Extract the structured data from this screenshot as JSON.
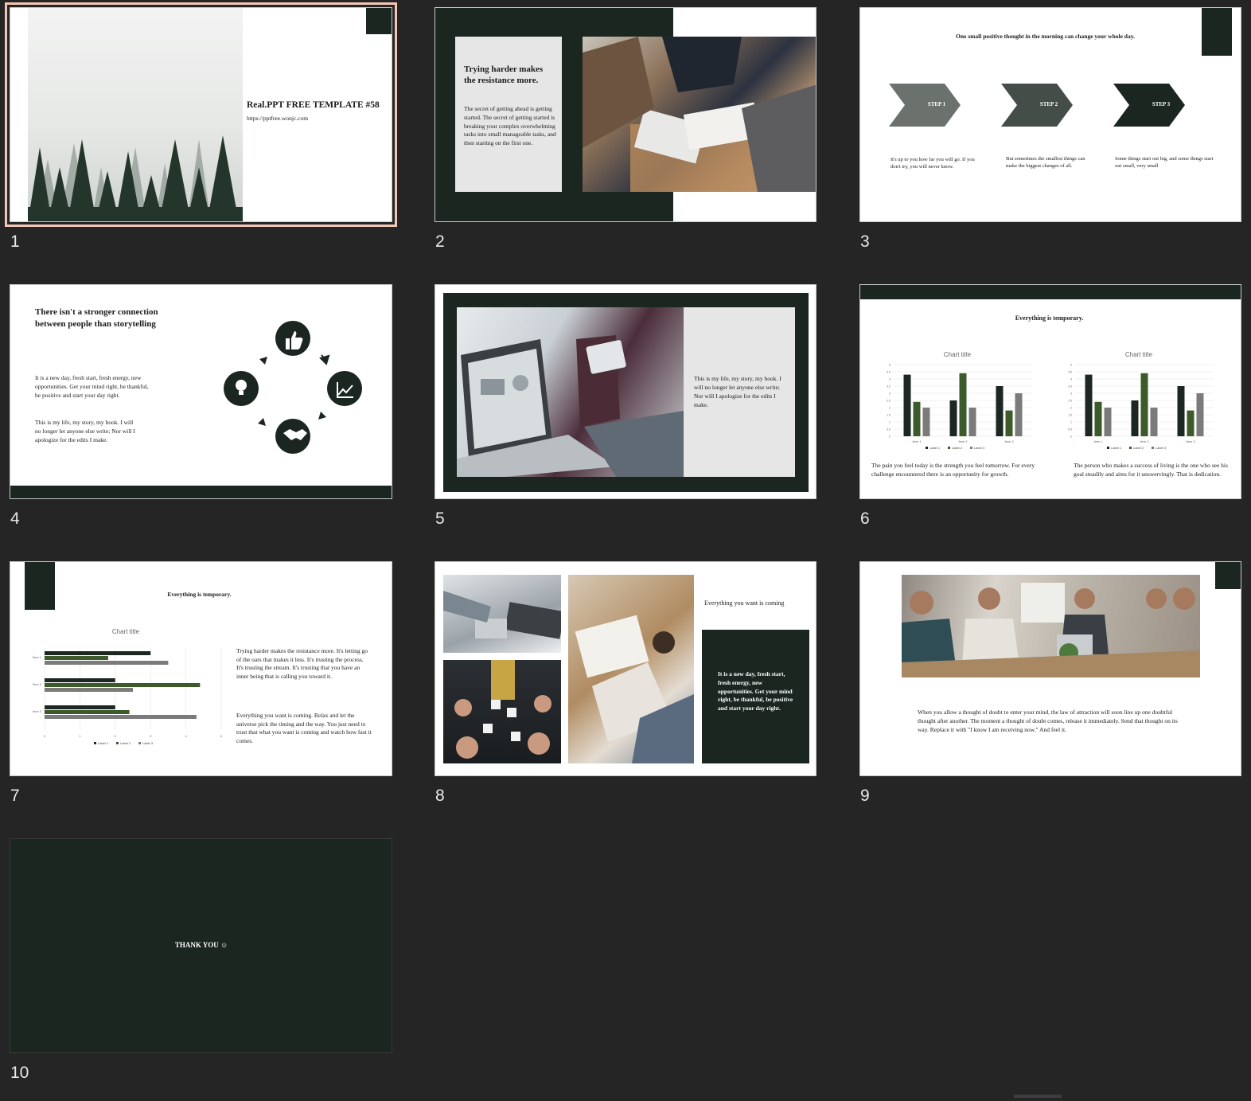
{
  "colors": {
    "background": "#252526",
    "dark_green": "#1b2621",
    "step1": "#6b726d",
    "step2": "#454d48",
    "step3": "#1b2621",
    "bar_dark": "#1c2722",
    "bar_green": "#3d5a2a",
    "bar_gray": "#7b7b7b",
    "selection": "#f4c7b4"
  },
  "slide_numbers": [
    "1",
    "2",
    "3",
    "4",
    "5",
    "6",
    "7",
    "8",
    "9",
    "10"
  ],
  "s1": {
    "title": "Real.PPT FREE TEMPLATE #58",
    "url": "https://pptfree.wonjc.com"
  },
  "s2": {
    "title": "Trying harder makes the resistance more.",
    "body": "The secret of getting ahead is getting started. The secret of getting started is breaking your complex overwhelming tasks into small manageable tasks, and then starting on the first one."
  },
  "s3": {
    "heading": "One small positive thought in the morning can change your whole day.",
    "steps": [
      "STEP 1",
      "STEP 2",
      "STEP 3"
    ],
    "texts": [
      "It's up to you how far you will go. If you don't try, you will never know.",
      "But sometimes the smallest things can make the biggest changes of all.",
      "Some things start out big, and some things start out small, very small"
    ]
  },
  "s4": {
    "title": "There isn't a stronger connection between people than storytelling",
    "body1": "It is a new day, fresh start, fresh energy, new opportunities. Get your mind right, be thankful, be positive and start your day right.",
    "body2": "This is my life, my story, my book. I will no longer let anyone else write; Nor will I apologize for the edits I make.",
    "icons": [
      "thumbs-up",
      "chart-growth",
      "handshake",
      "lightbulb"
    ]
  },
  "s5": {
    "body": "This is my life, my story, my book. I will no longer let anyone else write; Nor will I apologize for the edits I make."
  },
  "s6": {
    "heading": "Everything is temporary.",
    "caption_left": "The pain you feel today is the strength you feel tomorrow. For every challenge encountered there is an opportunity for growth.",
    "caption_right": "The person who makes a success of living is the one who see his goal steadily and aims for it unswervingly. That is dedication."
  },
  "s7": {
    "heading": "Everything is temporary.",
    "para1": "Trying harder makes the resistance more. It's letting go of the oars that makes it less. It's trusting the process. It's trusting the stream. It's trusting that you have an inner being that is calling you toward it.",
    "para2": "Everything you want is coming. Relax and let the universe pick the timing and the way. You just need to trust that what you want is coming and watch how fast it comes."
  },
  "s8": {
    "heading": "Everything you want is coming",
    "body": "It is a new day, fresh start, fresh energy, new opportunities. Get your mind right, be thankful, be positive and start your day right."
  },
  "s9": {
    "body": "When you allow a thought of doubt to enter your mind, the law of attraction will soon line up one doubtful thought after another. The moment a thought of doubt comes, release it immediately. Send that thought on its way. Replace it with \"I know I am receiving now.\" And feel it."
  },
  "s10": {
    "text": "THANK YOU ☺"
  },
  "chart_data": [
    {
      "type": "bar",
      "title": "Chart title",
      "categories": [
        "Item 1",
        "Item 2",
        "Item 3"
      ],
      "ylim": [
        0,
        5
      ],
      "series": [
        {
          "name": "Label 1",
          "values": [
            4.3,
            2.5,
            3.5
          ]
        },
        {
          "name": "Label 2",
          "values": [
            2.4,
            4.4,
            1.8
          ]
        },
        {
          "name": "Label 3",
          "values": [
            2,
            2,
            3
          ]
        }
      ]
    },
    {
      "type": "bar",
      "title": "Chart title",
      "categories": [
        "Item 1",
        "Item 2",
        "Item 3"
      ],
      "ylim": [
        0,
        5
      ],
      "series": [
        {
          "name": "Label 1",
          "values": [
            4.3,
            2.5,
            3.5
          ]
        },
        {
          "name": "Label 2",
          "values": [
            2.4,
            4.4,
            1.8
          ]
        },
        {
          "name": "Label 3",
          "values": [
            2,
            2,
            3
          ]
        }
      ]
    },
    {
      "type": "bar",
      "orientation": "horizontal",
      "title": "Chart title",
      "categories": [
        "Item 1",
        "Item 2",
        "Item 3"
      ],
      "xlim": [
        0,
        5
      ],
      "series": [
        {
          "name": "Label 1",
          "values": [
            3,
            2,
            2
          ]
        },
        {
          "name": "Label 2",
          "values": [
            1.8,
            4.4,
            2.4
          ]
        },
        {
          "name": "Label 3",
          "values": [
            3.5,
            2.5,
            4.3
          ]
        }
      ]
    }
  ]
}
